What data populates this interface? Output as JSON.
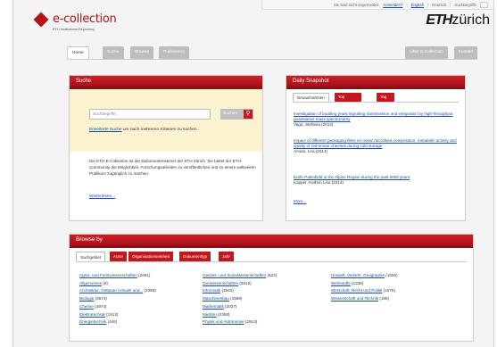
{
  "util": {
    "login_text": "Sie sind nicht angemeldet.",
    "login_link": "Anmelden?",
    "lang_en": "English",
    "lang_de": "Deutsch",
    "search_hint": "Suchbegriffe"
  },
  "header": {
    "logo_name": "e-collection",
    "logo_sub": "ETH Institutional Repository",
    "eth_bold": "ETH",
    "eth_rest": "zürich"
  },
  "nav": {
    "home": "Home",
    "suche": "Suche",
    "browse": "Browse",
    "publizieren": "Publizieren",
    "about": "Über E-Collection",
    "kontakt": "Kontakt"
  },
  "suche": {
    "title": "Suche",
    "placeholder": "Suchbegriffe...",
    "button": "Suchen",
    "adv_link": "Erweiterte Suche",
    "adv_rest": " um nach mehreren Kriterien zu suchen.",
    "description": "Die ETH E-Collection ist der Dokumentenserver der ETH Zürich. Sie bietet der ETH-Community die Möglichkeit, Forschungsarbeiten zu veröffentlichen und so einem weltweiten Publikum zugänglich zu machen.",
    "more": "Weiterlesen..."
  },
  "daily": {
    "title": "Daily Snapshot",
    "tabs": [
      "Neuaufnahmen",
      "Top Downloads",
      "Tag Cloud"
    ],
    "items": [
      {
        "title": "Investigation of budding yeast signaling transmission and integration by high-throughput quantitative mass spectrometry",
        "author": "Vaga, Stefania (2013)"
      },
      {
        "title": "Impact of different packaging films on onear microflora composition, metabolic activity and quality of red-smear cheeses during cold storage",
        "author": "Amato, Lea (2014)"
      },
      {
        "title": "Earth Paleofield in the Alpine Region during the past 8000 years",
        "author": "Kapper, Kathrin Lisa (2014)"
      }
    ],
    "more": "More..."
  },
  "browse": {
    "title": "Browse by",
    "tabs": [
      "Sachgebiet",
      "Autor",
      "Organisationseinheit",
      "Dokumenttyp",
      "Jahr"
    ],
    "col1": [
      {
        "name": "Agrar- und Forstwissenschaften",
        "count": "(2661)"
      },
      {
        "name": "Allgemeines",
        "count": "(8)"
      },
      {
        "name": "Architektur, Gebaute Umwelt und...",
        "count": "(2059)"
      },
      {
        "name": "Biologie",
        "count": "(3574)"
      },
      {
        "name": "Chemie",
        "count": "(4974)"
      },
      {
        "name": "Elektrotechnik",
        "count": "(1913)"
      },
      {
        "name": "Energietechnik",
        "count": "(446)"
      }
    ],
    "col2": [
      {
        "name": "Geistes- und Sozialwissenschaften",
        "count": "(623)"
      },
      {
        "name": "Geowissenschaften",
        "count": "(3612)"
      },
      {
        "name": "Informatik",
        "count": "(2943)"
      },
      {
        "name": "Maschinenbau",
        "count": "(1589)"
      },
      {
        "name": "Mathematik",
        "count": "(2037)"
      },
      {
        "name": "Medizin",
        "count": "(2358)"
      },
      {
        "name": "Physik und Astronomie",
        "count": "(2913)"
      }
    ],
    "col3": [
      {
        "name": "Umwelt, Verkehr, Geographie",
        "count": "(1555)"
      },
      {
        "name": "Werkstoffe",
        "count": "(1336)"
      },
      {
        "name": "Wirtschaft, Recht und Politik",
        "count": "(1976)"
      },
      {
        "name": "Wissenschaft und Technik",
        "count": "(198)"
      }
    ]
  },
  "colors": {
    "brand_red": "#b3121b",
    "link": "#1a4fa0",
    "highlight": "#fbf3cf"
  }
}
